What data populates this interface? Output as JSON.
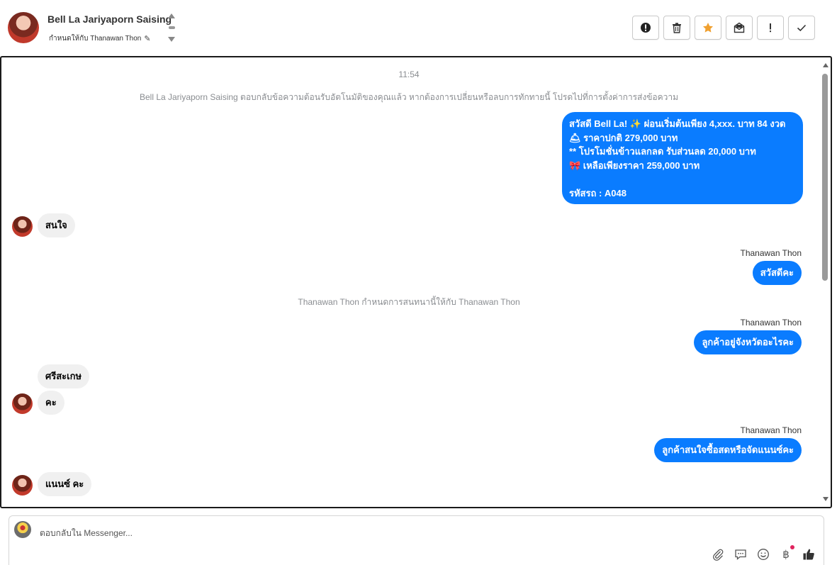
{
  "header": {
    "contact_name": "Bell La Jariyaporn Saising",
    "assignment_text": "กำหนดให้กับ Thanawan Thon",
    "actions": [
      {
        "name": "spam-button",
        "icon": "exclamation-circle-icon"
      },
      {
        "name": "delete-button",
        "icon": "trash-icon"
      },
      {
        "name": "star-button",
        "icon": "star-icon",
        "color": "#f0a030"
      },
      {
        "name": "mark-unread-button",
        "icon": "envelope-open-icon"
      },
      {
        "name": "important-button",
        "icon": "exclamation-icon"
      },
      {
        "name": "done-button",
        "icon": "check-icon"
      }
    ]
  },
  "chat": {
    "timestamp": "11:54",
    "auto_reply_notice": "Bell La Jariyaporn Saising ตอบกลับข้อความต้อนรับอัตโนมัติของคุณแล้ว หากต้องการเปลี่ยนหรือลบการทักทายนี้ โปรดไปที่การตั้งค่าการส่งข้อความ",
    "promo_message": {
      "line1": "สวัสดี Bell La! ✨  ผ่อนเริ่มต้นเพียง 4,xxx. บาท 84 งวด",
      "line2": "🛎 ราคาปกติ 279,000 บาท",
      "line3": "** โปรโมชั่นข้าวแลกลด รับส่วนลด 20,000 บาท",
      "line4": "🎀  เหลือเพียงราคา 259,000 บาท",
      "line5": "",
      "line6": " รหัสรถ : A048"
    },
    "msg_in_1": "สนใจ",
    "sender_1": "Thanawan Thon",
    "msg_out_1": "สวัสดีคะ",
    "assign_notice": "Thanawan Thon กำหนดการสนทนานี้ให้กับ Thanawan Thon",
    "sender_2": "Thanawan Thon",
    "msg_out_2": "ลูกค้าอยู่จังหวัดอะไรคะ",
    "msg_in_2": "ศรีสะเกษ",
    "msg_in_3": "คะ",
    "sender_3": "Thanawan Thon",
    "msg_out_3": "ลูกค้าสนใจซื้อสดหรือจัดแนนซ์คะ",
    "msg_in_4": "แนนซ์ คะ",
    "accent_color": "#0a7cff"
  },
  "composer": {
    "placeholder": "ตอบกลับใน Messenger...",
    "tools": [
      "paperclip-icon",
      "chat-bubble-icon",
      "smiley-icon",
      "baht-icon",
      "thumbs-up-icon"
    ],
    "baht_symbol": "฿"
  }
}
